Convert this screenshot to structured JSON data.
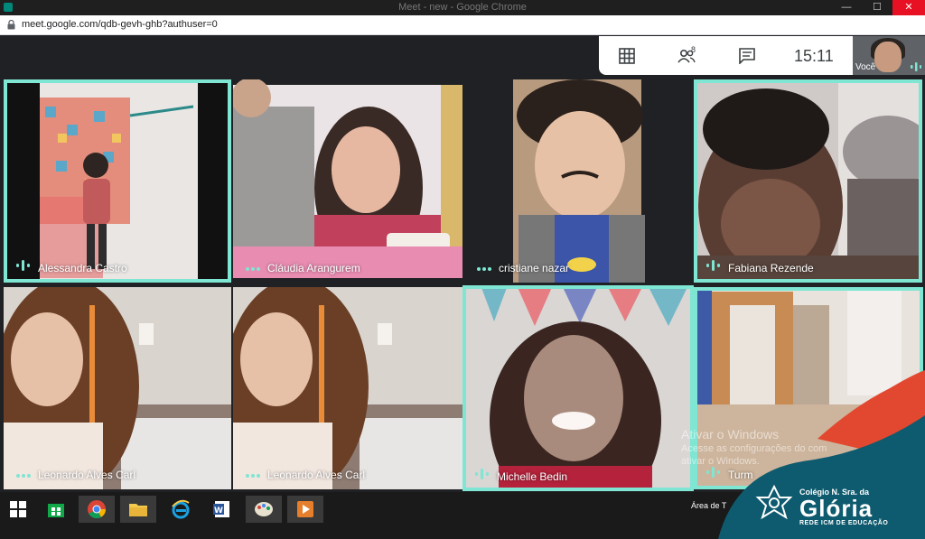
{
  "window": {
    "title": "Meet - new - Google Chrome",
    "minimize": "—",
    "maximize": "☐",
    "close": "✕"
  },
  "address": {
    "url": "meet.google.com/qdb-gevh-ghb?authuser=0"
  },
  "meet": {
    "participants_count": "8",
    "clock": "15:11",
    "self_label": "Você"
  },
  "tiles": [
    {
      "name": "Alessandra Castro",
      "active": true,
      "indicator": "speaking"
    },
    {
      "name": "Cláudia Arangurem",
      "active": false,
      "indicator": "more"
    },
    {
      "name": "cristiane nazar",
      "active": false,
      "indicator": "more"
    },
    {
      "name": "Fabiana Rezende",
      "active": true,
      "indicator": "speaking"
    },
    {
      "name": "Leonardo Alves Carl",
      "active": false,
      "indicator": "more"
    },
    {
      "name": "Leonardo Alves Carl",
      "active": false,
      "indicator": "more"
    },
    {
      "name": "Michelle Bedin",
      "active": true,
      "indicator": "speaking"
    },
    {
      "name": "Turm",
      "active": true,
      "indicator": "speaking"
    }
  ],
  "watermark": {
    "line1": "Ativar o Windows",
    "line2": "Acesse as configurações do com",
    "line3": "ativar o Windows."
  },
  "taskbar": {
    "desktop_label": "Área de T"
  },
  "brand": {
    "small": "Colégio N. Sra. da",
    "big": "Glória",
    "tag": "REDE ICM DE EDUCAÇÃO"
  },
  "colors": {
    "active_border": "#7ee6d3",
    "brand_teal": "#0e5a6e",
    "brand_red": "#e2482f"
  }
}
